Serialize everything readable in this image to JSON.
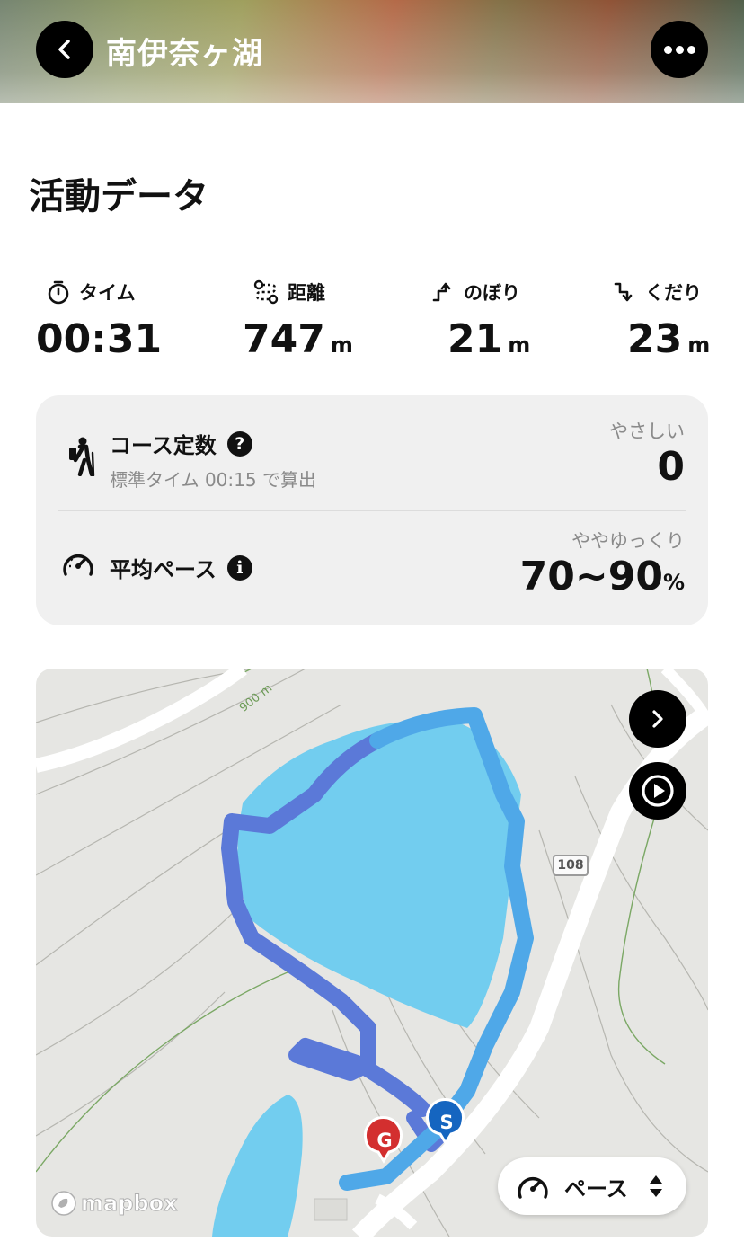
{
  "header": {
    "title": "南伊奈ヶ湖"
  },
  "section": {
    "title": "活動データ"
  },
  "stats": {
    "time": {
      "label": "タイム",
      "value": "00:31",
      "unit": ""
    },
    "distance": {
      "label": "距離",
      "value": "747",
      "unit": "m"
    },
    "ascent": {
      "label": "のぼり",
      "value": "21",
      "unit": "m"
    },
    "descent": {
      "label": "くだり",
      "value": "23",
      "unit": "m"
    }
  },
  "course": {
    "title": "コース定数",
    "help": "?",
    "subtitle": "標準タイム 00:15 で算出",
    "rating_label": "やさしい",
    "value": "0"
  },
  "pace": {
    "title": "平均ペース",
    "info": "i",
    "rating_label": "ややゆっくり",
    "value": "70~90",
    "unit": "%"
  },
  "map": {
    "contour_label": "900 m",
    "road_number": "108",
    "start_marker": "S",
    "goal_marker": "G",
    "attribution": "mapbox",
    "chip_label": "ペース",
    "colors": {
      "lake": "#72cdef",
      "route_outbound": "#5b79d8",
      "route_return": "#4fa8e8",
      "start": "#1565c0",
      "goal": "#d32f2f"
    }
  }
}
